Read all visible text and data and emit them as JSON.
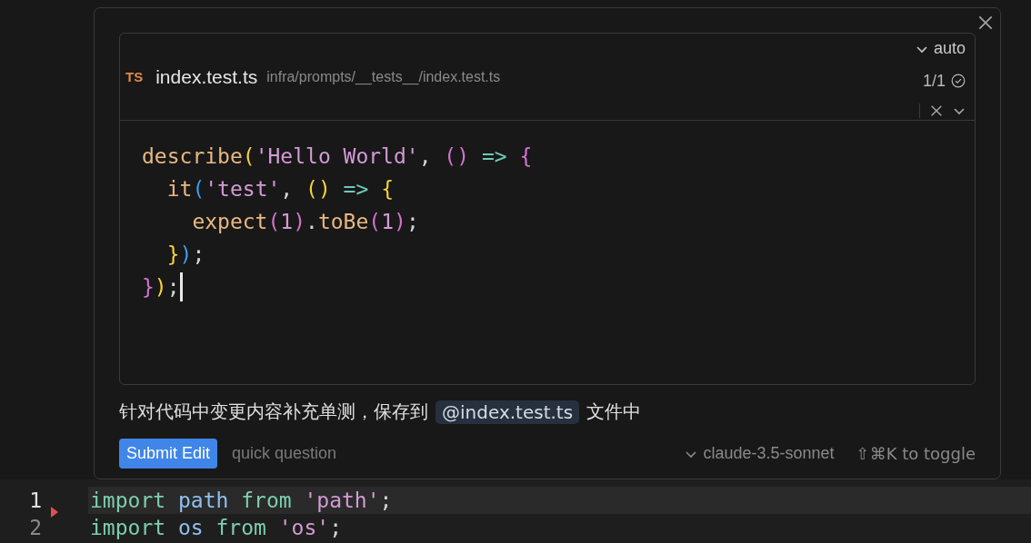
{
  "edit_panel": {
    "file_header": {
      "language_badge": "TS",
      "filename": "index.test.ts",
      "path": "infra/prompts/__tests__/index.test.ts",
      "mode": "auto",
      "diff_count": "1/1"
    },
    "code_lines": [
      {
        "cursor": false,
        "tokens": [
          {
            "kind": "fn",
            "text": "describe"
          },
          {
            "kind": "paren1",
            "text": "("
          },
          {
            "kind": "string",
            "text": "'Hello World'"
          },
          {
            "kind": "punct",
            "text": ", "
          },
          {
            "kind": "paren2",
            "text": "()"
          },
          {
            "kind": "arrow",
            "text": " => "
          },
          {
            "kind": "paren2",
            "text": "{"
          }
        ]
      },
      {
        "cursor": false,
        "tokens": [
          {
            "kind": "fn",
            "text": "  it"
          },
          {
            "kind": "paren3",
            "text": "("
          },
          {
            "kind": "string",
            "text": "'test'"
          },
          {
            "kind": "punct",
            "text": ", "
          },
          {
            "kind": "paren1",
            "text": "()"
          },
          {
            "kind": "arrow",
            "text": " => "
          },
          {
            "kind": "paren1",
            "text": "{"
          }
        ]
      },
      {
        "cursor": false,
        "tokens": [
          {
            "kind": "fn",
            "text": "    expect"
          },
          {
            "kind": "paren2",
            "text": "("
          },
          {
            "kind": "number",
            "text": "1"
          },
          {
            "kind": "paren2",
            "text": ")"
          },
          {
            "kind": "punct",
            "text": "."
          },
          {
            "kind": "fn",
            "text": "toBe"
          },
          {
            "kind": "paren2",
            "text": "("
          },
          {
            "kind": "number",
            "text": "1"
          },
          {
            "kind": "paren2",
            "text": ")"
          },
          {
            "kind": "punct",
            "text": ";"
          }
        ]
      },
      {
        "cursor": false,
        "tokens": [
          {
            "kind": "paren1",
            "text": "  }"
          },
          {
            "kind": "paren3",
            "text": ")"
          },
          {
            "kind": "punct",
            "text": ";"
          }
        ]
      },
      {
        "cursor": true,
        "tokens": [
          {
            "kind": "paren2",
            "text": "}"
          },
          {
            "kind": "paren1",
            "text": ")"
          },
          {
            "kind": "punct",
            "text": ";"
          }
        ]
      }
    ],
    "prompt": [
      {
        "kind": "text",
        "text": "针对代码中变更内容补充单测，保存到"
      },
      {
        "kind": "mention",
        "text": "@index.test.ts"
      },
      {
        "kind": "text",
        "text": "文件中"
      }
    ],
    "footer": {
      "submit_button": "Submit Edit",
      "secondary_button": "quick question",
      "model": "claude-3.5-sonnet",
      "shortcut_hint": "⇧⌘K to toggle"
    }
  },
  "editor": {
    "lines": [
      {
        "number": "1",
        "current": true,
        "marker": true,
        "tokens": [
          {
            "kind": "keyword",
            "text": "import"
          },
          {
            "kind": "ident",
            "text": " path"
          },
          {
            "kind": "keyword",
            "text": " from"
          },
          {
            "kind": "string",
            "text": " 'path'"
          },
          {
            "kind": "punct",
            "text": ";"
          }
        ]
      },
      {
        "number": "2",
        "current": false,
        "marker": false,
        "tokens": [
          {
            "kind": "keyword",
            "text": "import"
          },
          {
            "kind": "ident",
            "text": " os"
          },
          {
            "kind": "keyword",
            "text": " from"
          },
          {
            "kind": "string",
            "text": " 'os'"
          },
          {
            "kind": "punct",
            "text": ";"
          }
        ]
      }
    ]
  }
}
